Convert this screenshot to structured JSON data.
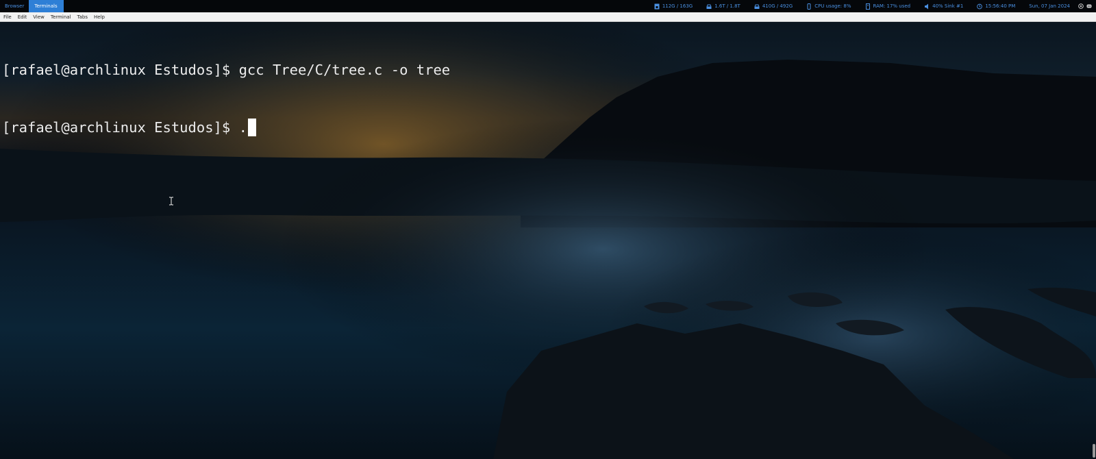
{
  "panel": {
    "tabs": [
      {
        "label": "Browser",
        "active": false
      },
      {
        "label": "Terminals",
        "active": true
      }
    ],
    "status": [
      {
        "icon": "home-disk-icon",
        "text": "112G  /  163G"
      },
      {
        "icon": "drive-icon",
        "text": "1.6T  /  1.8T"
      },
      {
        "icon": "drive-icon",
        "text": "410G  /  492G"
      },
      {
        "icon": "cpu-icon",
        "text": "CPU usage: 8%"
      },
      {
        "icon": "memory-icon",
        "text": "RAM: 17% used"
      },
      {
        "icon": "volume-icon",
        "text": "40% Sink #1"
      },
      {
        "icon": "clock-icon",
        "text": "15:56:40 PM"
      },
      {
        "icon": "",
        "text": "Sun, 07 Jan 2024"
      }
    ],
    "accent_color": "#4a90e2",
    "active_tab_color": "#2e7fd6"
  },
  "menubar": {
    "items": [
      "File",
      "Edit",
      "View",
      "Terminal",
      "Tabs",
      "Help"
    ]
  },
  "terminal": {
    "lines": [
      "[rafael@archlinux Estudos]$ gcc Tree/C/tree.c -o tree",
      "[rafael@archlinux Estudos]$ ."
    ],
    "text_color": "#ececec"
  }
}
